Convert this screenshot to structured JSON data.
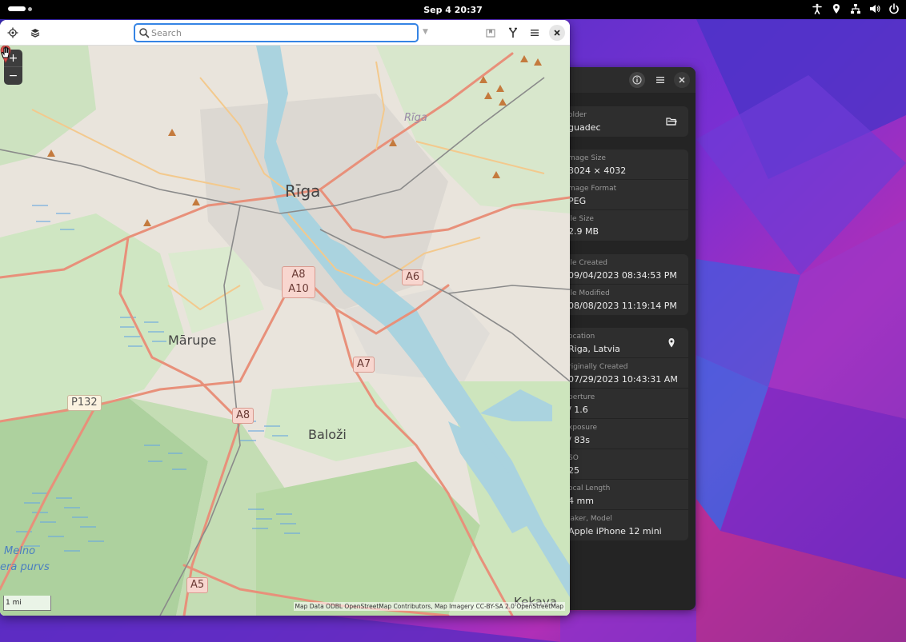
{
  "topbar": {
    "clock": "Sep 4  20:37",
    "icons": [
      "accessibility-icon",
      "location-icon",
      "network-icon",
      "volume-icon",
      "power-icon"
    ]
  },
  "map_window": {
    "search": {
      "placeholder": "Search",
      "value": ""
    },
    "zoom": {
      "in": "+",
      "out": "−"
    },
    "scale_label": "1 mi",
    "attribution": "Map Data ODBL OpenStreetMap Contributors, Map Imagery CC-BY-SA 2.0 OpenStreetMap",
    "places": {
      "riga_big": "Rīga",
      "riga_small": "Rīga",
      "marupe": "Mārupe",
      "balozi": "Baloži",
      "kekava": "Kekava",
      "melno": "Melno",
      "purvs": "era purvs"
    },
    "shields": {
      "a8_a10": [
        "A8",
        "A10"
      ],
      "a6": "A6",
      "a7": "A7",
      "a8": "A8",
      "p132": "P132",
      "a5": "A5"
    }
  },
  "viewer": {
    "groups": [
      {
        "rows": [
          {
            "label": "older",
            "value": "guadec",
            "icon": "folder-open-icon"
          }
        ]
      },
      {
        "rows": [
          {
            "label": "mage Size",
            "value": "3024 × 4032"
          },
          {
            "label": "mage Format",
            "value": "PEG"
          },
          {
            "label": "ile Size",
            "value": "2.9 MB"
          }
        ]
      },
      {
        "rows": [
          {
            "label": "ile Created",
            "value": "09/04/2023 08:34:53 PM"
          },
          {
            "label": "ile Modified",
            "value": "08/08/2023 11:19:14 PM"
          }
        ]
      },
      {
        "rows": [
          {
            "label": "ocation",
            "value": "Riga, Latvia",
            "icon": "location-pin-icon"
          },
          {
            "label": "riginally Created",
            "value": "07/29/2023 10:43:31 AM"
          },
          {
            "label": "perture",
            "value": "/ 1.6"
          },
          {
            "label": "xposure",
            "value": "/ 83s"
          },
          {
            "label": "SO",
            "value": "25"
          },
          {
            "label": "ocal Length",
            "value": "4 mm"
          },
          {
            "label": "laker, Model",
            "value": "Apple iPhone 12 mini"
          }
        ]
      }
    ]
  },
  "colors": {
    "accent": "#3584e4",
    "road_major": "#e8907a",
    "road_secondary": "#f3c98d",
    "water": "#aad3df",
    "forest": "#add19e",
    "panel_bg": "#242424"
  }
}
